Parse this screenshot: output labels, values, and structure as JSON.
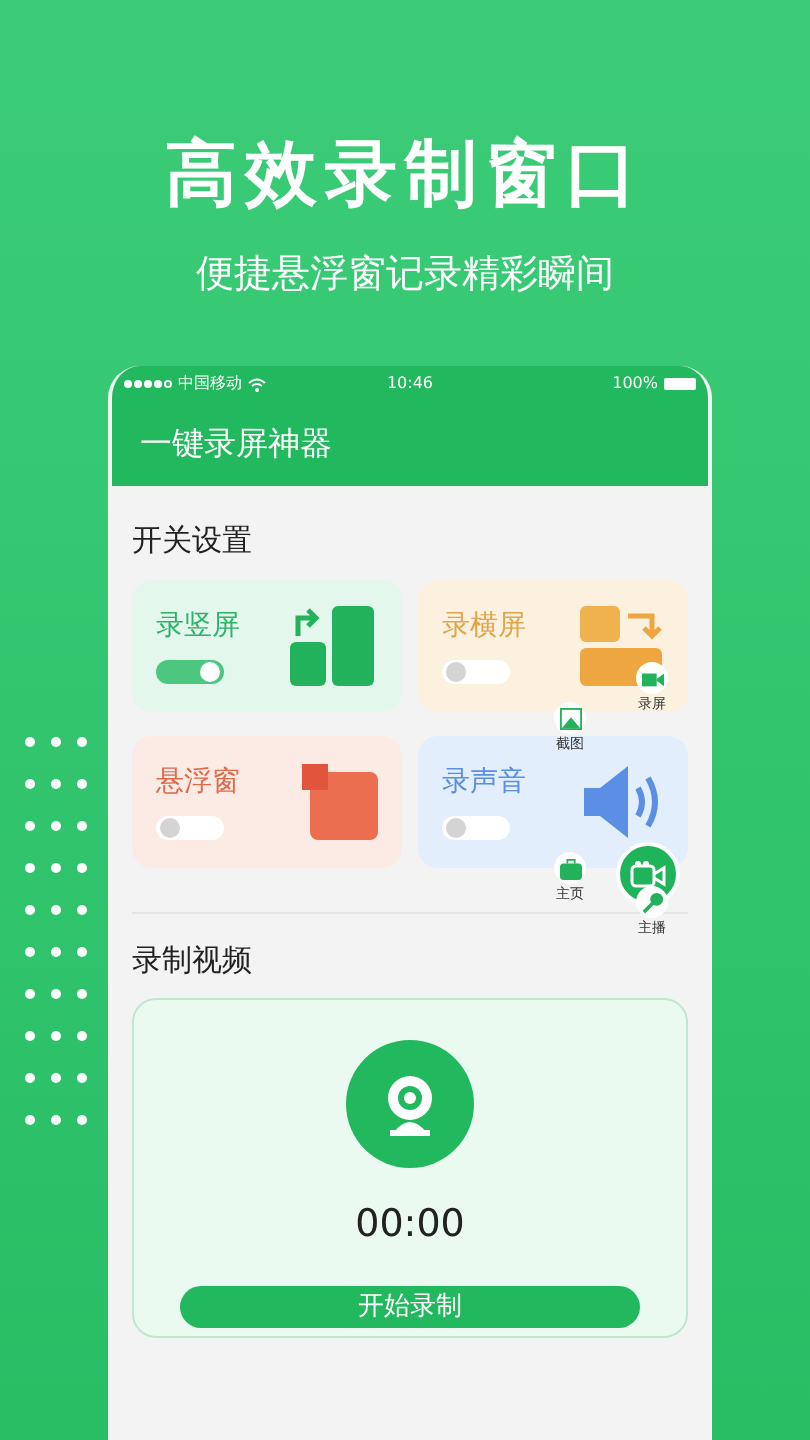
{
  "headline": "高效录制窗口",
  "subheadline": "便捷悬浮窗记录精彩瞬间",
  "status_bar": {
    "carrier": "中国移动",
    "time": "10:46",
    "battery": "100%"
  },
  "app_title": "一键录屏神器",
  "switch_section": {
    "title": "开关设置",
    "cards": [
      {
        "kind": "portrait",
        "label": "录竖屏",
        "on": true
      },
      {
        "kind": "landscape",
        "label": "录横屏",
        "on": false
      },
      {
        "kind": "floating",
        "label": "悬浮窗",
        "on": false
      },
      {
        "kind": "audio",
        "label": "录声音",
        "on": false
      }
    ]
  },
  "floating_menu": {
    "items": [
      {
        "kind": "record",
        "label": "录屏"
      },
      {
        "kind": "screenshot",
        "label": "截图"
      },
      {
        "kind": "home",
        "label": "主页"
      },
      {
        "kind": "anchor",
        "label": "主播"
      }
    ]
  },
  "record_section": {
    "title": "录制视频",
    "timer": "00:00",
    "start_button": "开始录制"
  }
}
